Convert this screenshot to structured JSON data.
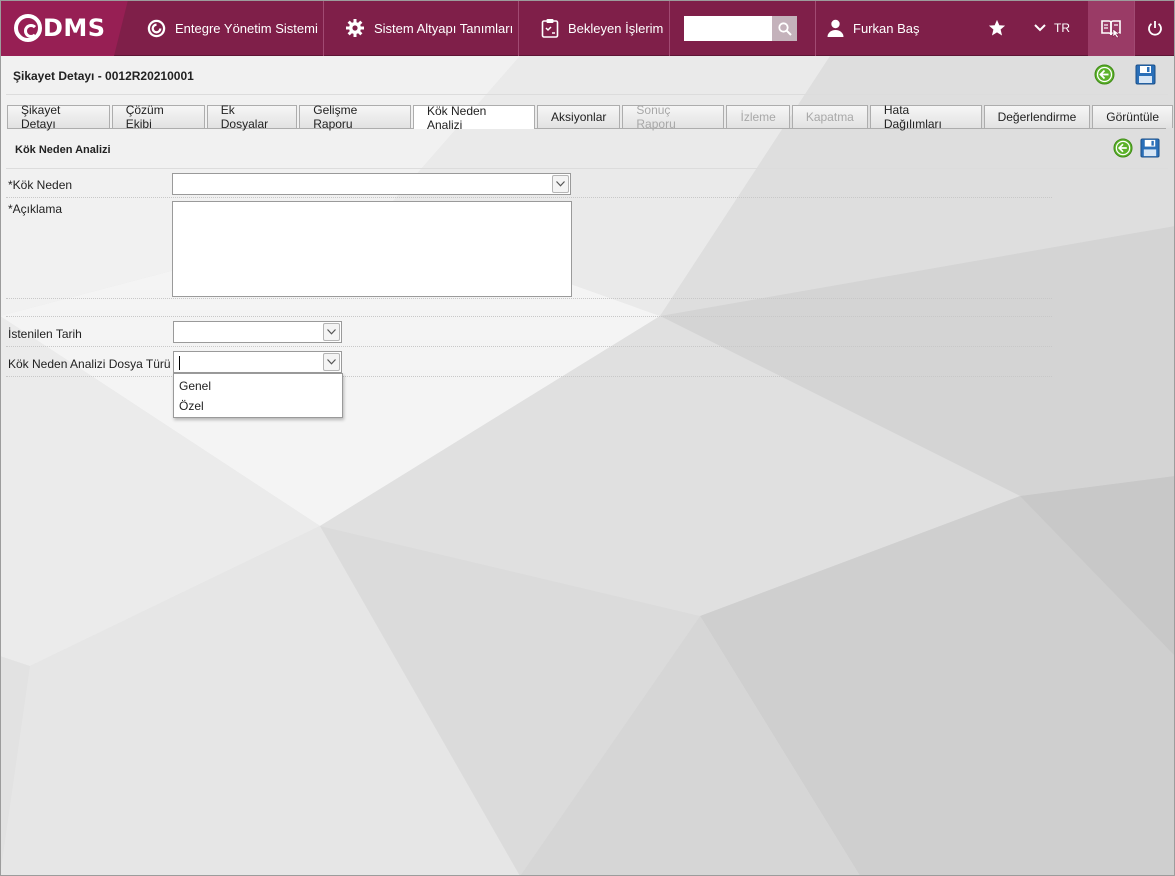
{
  "app": {
    "logo_text": "DMS",
    "colors": {
      "topbar": "#7f1f49",
      "logo_bg": "#971f54",
      "accent_green": "#6abf2a",
      "save_blue": "#2a6fb8"
    }
  },
  "topnav": {
    "items": [
      {
        "label": "Entegre Yönetim Sistemi",
        "icon": "qdms-circle-icon"
      },
      {
        "label": "Sistem Altyapı Tanımları",
        "icon": "gear-icon"
      },
      {
        "label": "Bekleyen İşlerim",
        "icon": "clipboard-icon"
      }
    ],
    "search": {
      "value": "",
      "placeholder": ""
    },
    "user_name": "Furkan Baş",
    "language": "TR"
  },
  "page": {
    "title": "Şikayet Detayı - 0012R20210001"
  },
  "tabs": [
    {
      "label": "Şikayet Detayı",
      "state": "normal"
    },
    {
      "label": "Çözüm Ekibi",
      "state": "normal"
    },
    {
      "label": "Ek Dosyalar",
      "state": "normal"
    },
    {
      "label": "Gelişme Raporu",
      "state": "normal"
    },
    {
      "label": "Kök Neden Analizi",
      "state": "active"
    },
    {
      "label": "Aksiyonlar",
      "state": "normal"
    },
    {
      "label": "Sonuç Raporu",
      "state": "disabled"
    },
    {
      "label": "İzleme",
      "state": "disabled"
    },
    {
      "label": "Kapatma",
      "state": "disabled"
    },
    {
      "label": "Hata Dağılımları",
      "state": "normal"
    },
    {
      "label": "Değerlendirme",
      "state": "normal"
    },
    {
      "label": "Görüntüle",
      "state": "normal"
    }
  ],
  "form": {
    "section_title": "Kök Neden Analizi",
    "kok_neden": {
      "label": "*Kök Neden",
      "value": ""
    },
    "aciklama": {
      "label": "*Açıklama",
      "value": ""
    },
    "istenilen_tarih": {
      "label": "İstenilen Tarih",
      "value": ""
    },
    "dosya_turu": {
      "label": "Kök Neden Analizi Dosya Türü",
      "value": "",
      "options": [
        "Genel",
        "Özel"
      ]
    }
  }
}
